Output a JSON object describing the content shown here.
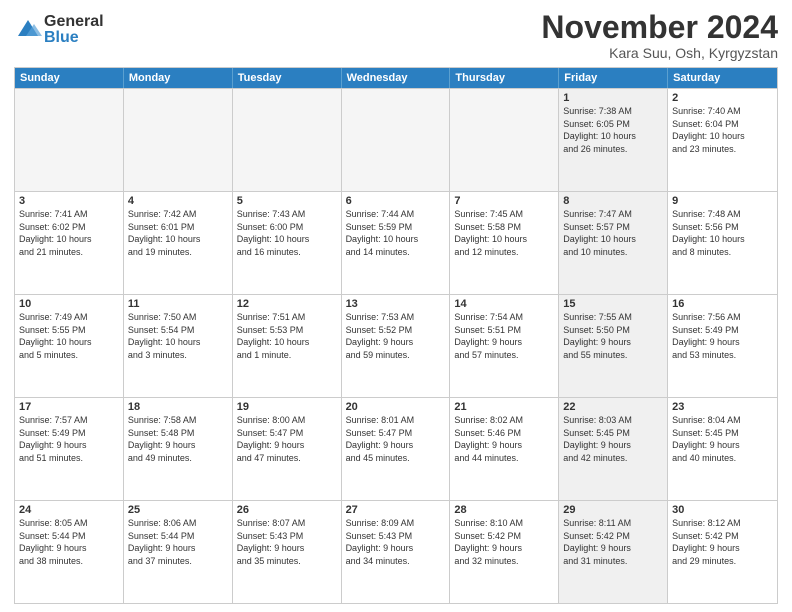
{
  "logo": {
    "general": "General",
    "blue": "Blue"
  },
  "title": "November 2024",
  "location": "Kara Suu, Osh, Kyrgyzstan",
  "weekdays": [
    "Sunday",
    "Monday",
    "Tuesday",
    "Wednesday",
    "Thursday",
    "Friday",
    "Saturday"
  ],
  "rows": [
    [
      {
        "day": "",
        "lines": [],
        "empty": true
      },
      {
        "day": "",
        "lines": [],
        "empty": true
      },
      {
        "day": "",
        "lines": [],
        "empty": true
      },
      {
        "day": "",
        "lines": [],
        "empty": true
      },
      {
        "day": "",
        "lines": [],
        "empty": true
      },
      {
        "day": "1",
        "lines": [
          "Sunrise: 7:38 AM",
          "Sunset: 6:05 PM",
          "Daylight: 10 hours",
          "and 26 minutes."
        ],
        "shaded": true
      },
      {
        "day": "2",
        "lines": [
          "Sunrise: 7:40 AM",
          "Sunset: 6:04 PM",
          "Daylight: 10 hours",
          "and 23 minutes."
        ],
        "shaded": false
      }
    ],
    [
      {
        "day": "3",
        "lines": [
          "Sunrise: 7:41 AM",
          "Sunset: 6:02 PM",
          "Daylight: 10 hours",
          "and 21 minutes."
        ]
      },
      {
        "day": "4",
        "lines": [
          "Sunrise: 7:42 AM",
          "Sunset: 6:01 PM",
          "Daylight: 10 hours",
          "and 19 minutes."
        ]
      },
      {
        "day": "5",
        "lines": [
          "Sunrise: 7:43 AM",
          "Sunset: 6:00 PM",
          "Daylight: 10 hours",
          "and 16 minutes."
        ]
      },
      {
        "day": "6",
        "lines": [
          "Sunrise: 7:44 AM",
          "Sunset: 5:59 PM",
          "Daylight: 10 hours",
          "and 14 minutes."
        ]
      },
      {
        "day": "7",
        "lines": [
          "Sunrise: 7:45 AM",
          "Sunset: 5:58 PM",
          "Daylight: 10 hours",
          "and 12 minutes."
        ]
      },
      {
        "day": "8",
        "lines": [
          "Sunrise: 7:47 AM",
          "Sunset: 5:57 PM",
          "Daylight: 10 hours",
          "and 10 minutes."
        ],
        "shaded": true
      },
      {
        "day": "9",
        "lines": [
          "Sunrise: 7:48 AM",
          "Sunset: 5:56 PM",
          "Daylight: 10 hours",
          "and 8 minutes."
        ]
      }
    ],
    [
      {
        "day": "10",
        "lines": [
          "Sunrise: 7:49 AM",
          "Sunset: 5:55 PM",
          "Daylight: 10 hours",
          "and 5 minutes."
        ]
      },
      {
        "day": "11",
        "lines": [
          "Sunrise: 7:50 AM",
          "Sunset: 5:54 PM",
          "Daylight: 10 hours",
          "and 3 minutes."
        ]
      },
      {
        "day": "12",
        "lines": [
          "Sunrise: 7:51 AM",
          "Sunset: 5:53 PM",
          "Daylight: 10 hours",
          "and 1 minute."
        ]
      },
      {
        "day": "13",
        "lines": [
          "Sunrise: 7:53 AM",
          "Sunset: 5:52 PM",
          "Daylight: 9 hours",
          "and 59 minutes."
        ]
      },
      {
        "day": "14",
        "lines": [
          "Sunrise: 7:54 AM",
          "Sunset: 5:51 PM",
          "Daylight: 9 hours",
          "and 57 minutes."
        ]
      },
      {
        "day": "15",
        "lines": [
          "Sunrise: 7:55 AM",
          "Sunset: 5:50 PM",
          "Daylight: 9 hours",
          "and 55 minutes."
        ],
        "shaded": true
      },
      {
        "day": "16",
        "lines": [
          "Sunrise: 7:56 AM",
          "Sunset: 5:49 PM",
          "Daylight: 9 hours",
          "and 53 minutes."
        ]
      }
    ],
    [
      {
        "day": "17",
        "lines": [
          "Sunrise: 7:57 AM",
          "Sunset: 5:49 PM",
          "Daylight: 9 hours",
          "and 51 minutes."
        ]
      },
      {
        "day": "18",
        "lines": [
          "Sunrise: 7:58 AM",
          "Sunset: 5:48 PM",
          "Daylight: 9 hours",
          "and 49 minutes."
        ]
      },
      {
        "day": "19",
        "lines": [
          "Sunrise: 8:00 AM",
          "Sunset: 5:47 PM",
          "Daylight: 9 hours",
          "and 47 minutes."
        ]
      },
      {
        "day": "20",
        "lines": [
          "Sunrise: 8:01 AM",
          "Sunset: 5:47 PM",
          "Daylight: 9 hours",
          "and 45 minutes."
        ]
      },
      {
        "day": "21",
        "lines": [
          "Sunrise: 8:02 AM",
          "Sunset: 5:46 PM",
          "Daylight: 9 hours",
          "and 44 minutes."
        ]
      },
      {
        "day": "22",
        "lines": [
          "Sunrise: 8:03 AM",
          "Sunset: 5:45 PM",
          "Daylight: 9 hours",
          "and 42 minutes."
        ],
        "shaded": true
      },
      {
        "day": "23",
        "lines": [
          "Sunrise: 8:04 AM",
          "Sunset: 5:45 PM",
          "Daylight: 9 hours",
          "and 40 minutes."
        ]
      }
    ],
    [
      {
        "day": "24",
        "lines": [
          "Sunrise: 8:05 AM",
          "Sunset: 5:44 PM",
          "Daylight: 9 hours",
          "and 38 minutes."
        ]
      },
      {
        "day": "25",
        "lines": [
          "Sunrise: 8:06 AM",
          "Sunset: 5:44 PM",
          "Daylight: 9 hours",
          "and 37 minutes."
        ]
      },
      {
        "day": "26",
        "lines": [
          "Sunrise: 8:07 AM",
          "Sunset: 5:43 PM",
          "Daylight: 9 hours",
          "and 35 minutes."
        ]
      },
      {
        "day": "27",
        "lines": [
          "Sunrise: 8:09 AM",
          "Sunset: 5:43 PM",
          "Daylight: 9 hours",
          "and 34 minutes."
        ]
      },
      {
        "day": "28",
        "lines": [
          "Sunrise: 8:10 AM",
          "Sunset: 5:42 PM",
          "Daylight: 9 hours",
          "and 32 minutes."
        ]
      },
      {
        "day": "29",
        "lines": [
          "Sunrise: 8:11 AM",
          "Sunset: 5:42 PM",
          "Daylight: 9 hours",
          "and 31 minutes."
        ],
        "shaded": true
      },
      {
        "day": "30",
        "lines": [
          "Sunrise: 8:12 AM",
          "Sunset: 5:42 PM",
          "Daylight: 9 hours",
          "and 29 minutes."
        ]
      }
    ]
  ]
}
